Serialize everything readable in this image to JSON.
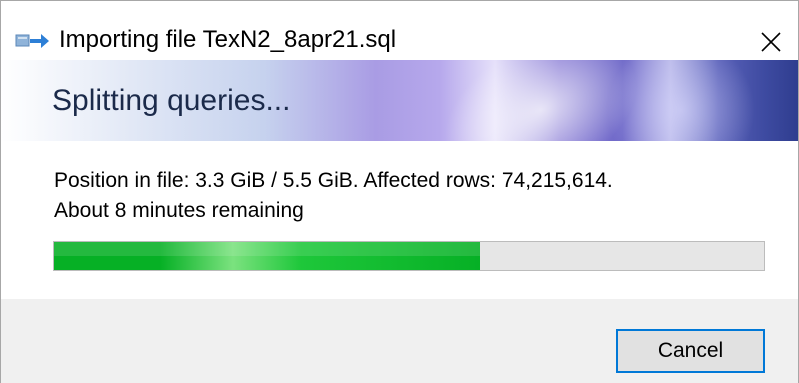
{
  "window": {
    "title": "Importing file TexN2_8apr21.sql",
    "icon": "import-arrow-icon",
    "close_icon": "close-icon"
  },
  "banner": {
    "title": "Splitting queries..."
  },
  "status": {
    "position_line": "Position in file: 3.3 GiB / 5.5 GiB. Affected rows: 74,215,614.",
    "time_remaining": "About 8 minutes remaining"
  },
  "progress": {
    "fraction": 0.6,
    "color": "#06b025"
  },
  "footer": {
    "cancel_label": "Cancel"
  },
  "colors": {
    "accent": "#0078d7",
    "footer_bg": "#f0f0f0"
  }
}
